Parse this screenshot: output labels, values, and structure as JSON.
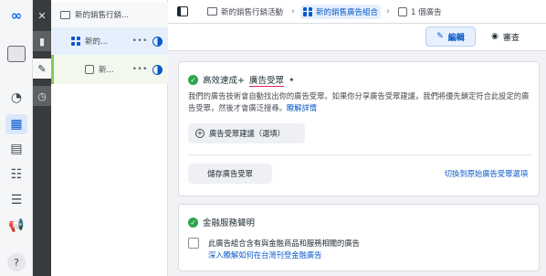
{
  "icons": {
    "rail": [
      "meta-logo-icon",
      "window-tile-icon",
      "dashboard-icon",
      "table-icon",
      "pages-icon",
      "audience-icon",
      "database-icon",
      "megaphone-icon",
      "help-icon"
    ],
    "strip": [
      "close-icon",
      "chart-icon",
      "pencil-icon",
      "clock-icon"
    ]
  },
  "rail": {
    "help_label": "?"
  },
  "tree": {
    "campaign": {
      "label": "新的銷售行銷..."
    },
    "adset": {
      "label": "新的...",
      "more": "•••"
    },
    "ad": {
      "label": "新...",
      "more": "•••"
    }
  },
  "breadcrumb": {
    "campaign": "新的銷售行銷活動",
    "adset": "新的銷售廣告組合",
    "ad": "1 個廣告"
  },
  "actions": {
    "edit": "編輯",
    "review": "審查"
  },
  "audience_card": {
    "title_prefix": "高效速成+",
    "title_highlight": "廣告受眾",
    "description": "我們的廣告技術會自動找出你的廣告受眾。如果你分享廣告受眾建議，我們將優先鎖定符合此設定的廣告受眾，然後才會廣泛搜尋。",
    "learn_more": "瞭解詳情",
    "suggestion_button": "廣告受眾建議（選填）",
    "save_button": "儲存廣告受眾",
    "switch_link": "切換到原始廣告受眾選項"
  },
  "financial_card": {
    "title": "金融服務聲明",
    "checkbox_label": "此廣告組合含有與金融商品和服務相關的廣告",
    "link": "深入瞭解如何在台灣刊登金融廣告"
  },
  "colors": {
    "accent": "#0a58ca",
    "success": "#2ea44f",
    "tree_marker": "#86c95a"
  }
}
